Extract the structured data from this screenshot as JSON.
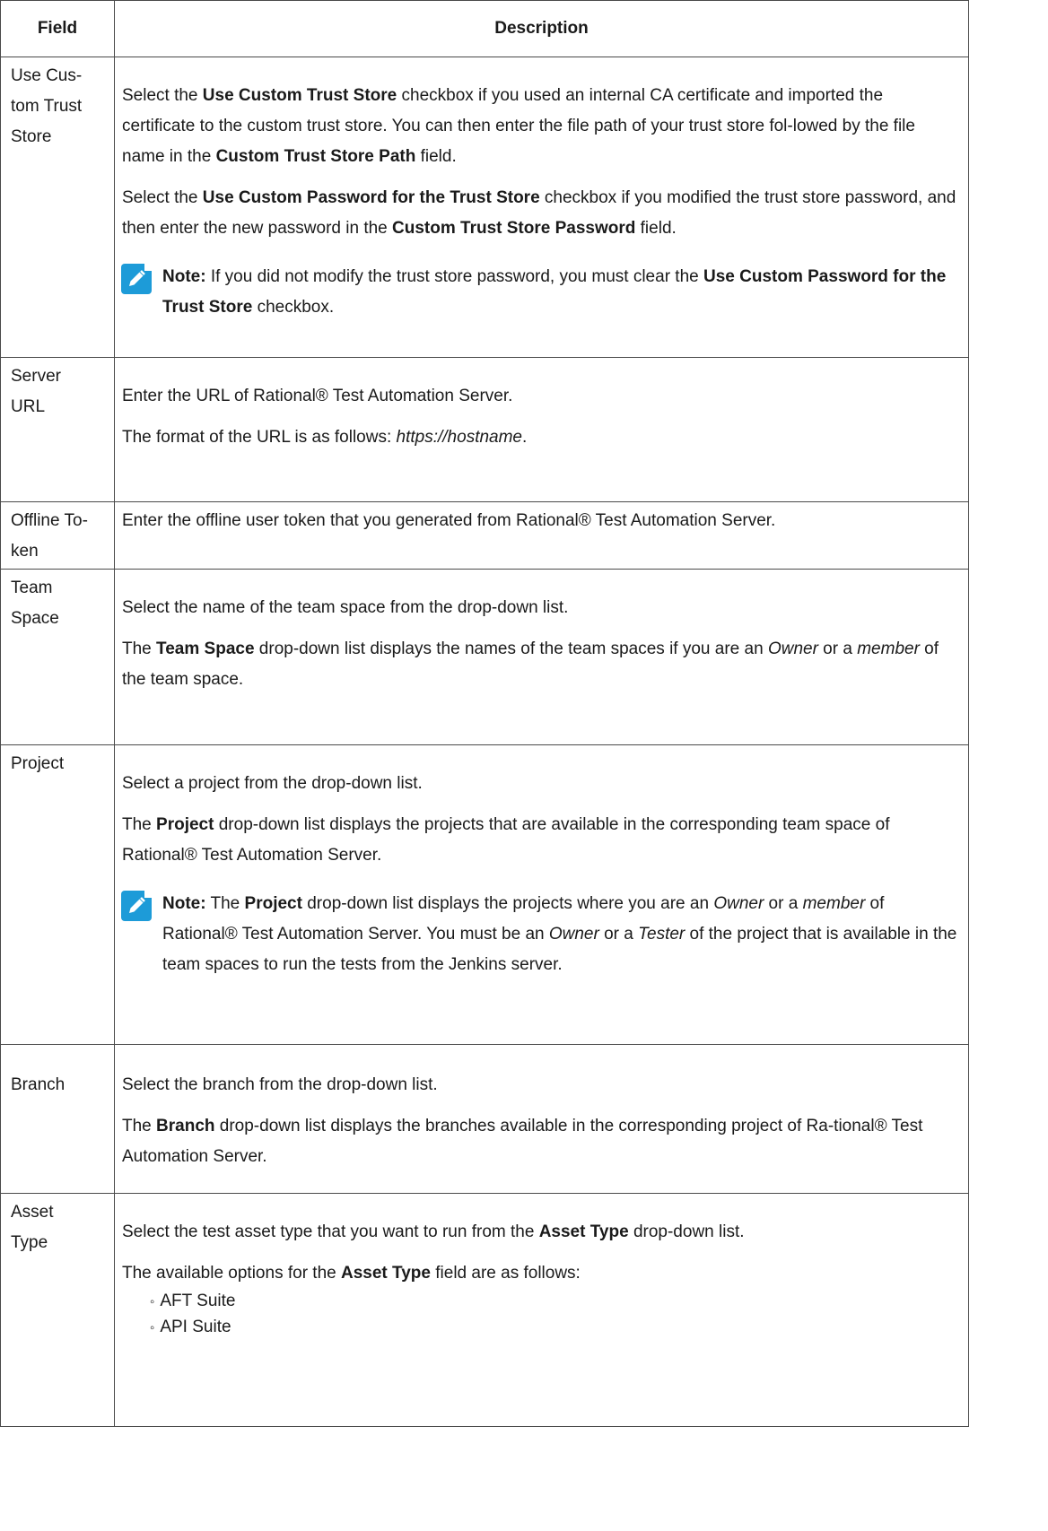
{
  "header": {
    "field": "Field",
    "description": "Description"
  },
  "rows": {
    "trust": {
      "field": "Use Cus-\ntom Trust\nStore",
      "p1": [
        "Select the ",
        "Use Custom Trust Store",
        " checkbox if you used an internal CA certificate and imported the certificate to the custom trust store. You can then enter the file path of your trust store fol-lowed by the file name in the ",
        "Custom Trust Store Path",
        " field."
      ],
      "p2": [
        "Select the ",
        "Use Custom Password for the Trust Store",
        " checkbox if you modified the trust store password, and then enter the new password in the ",
        "Custom Trust Store Password",
        " field."
      ],
      "note": [
        "Note:",
        " If you did not modify the trust store password, you must clear the ",
        "Use Custom Password for the Trust Store",
        " checkbox."
      ]
    },
    "server": {
      "field": "Server\nURL",
      "p1": "Enter the URL of Rational® Test Automation Server.",
      "p2": [
        "The format of the URL is as follows: ",
        "https://hostname",
        "."
      ]
    },
    "token": {
      "field": "Offline To-\nken",
      "p1": "Enter the offline user token that you generated from Rational® Test Automation Server."
    },
    "team": {
      "field": "Team\nSpace",
      "p1": "Select the name of the team space from the drop-down list.",
      "p2": [
        "The ",
        "Team Space",
        " drop-down list displays the names of the team spaces if you are an ",
        "Owner",
        " or a ",
        "member",
        " of the team space."
      ]
    },
    "project": {
      "field": "Project",
      "p1": "Select a project from the drop-down list.",
      "p2": [
        "The ",
        "Project",
        " drop-down list displays the projects that are available in the corresponding team space of Rational® Test Automation Server."
      ],
      "note": [
        "Note:",
        " The ",
        "Project",
        " drop-down list displays the projects where you are an ",
        "Owner",
        " or a ",
        "member",
        " of Rational® Test Automation Server. You must be an ",
        "Owner",
        " or a ",
        "Tester",
        " of the project that is available in the team spaces to run the tests from the Jenkins server."
      ]
    },
    "branch": {
      "field": "Branch",
      "p1": "Select the branch from the drop-down list.",
      "p2": [
        "The ",
        "Branch",
        " drop-down list displays the branches available in the corresponding project of Ra-tional® Test Automation Server."
      ]
    },
    "asset": {
      "field": "Asset\nType",
      "p1": [
        "Select the test asset type that you want to run from the ",
        "Asset Type",
        " drop-down list."
      ],
      "p2": [
        "The available options for the ",
        "Asset Type",
        " field are as follows:"
      ],
      "options": [
        "AFT Suite",
        "API Suite"
      ]
    }
  },
  "icons": {
    "note": "note-pencil-icon",
    "note_color": "#1d9bd8"
  }
}
